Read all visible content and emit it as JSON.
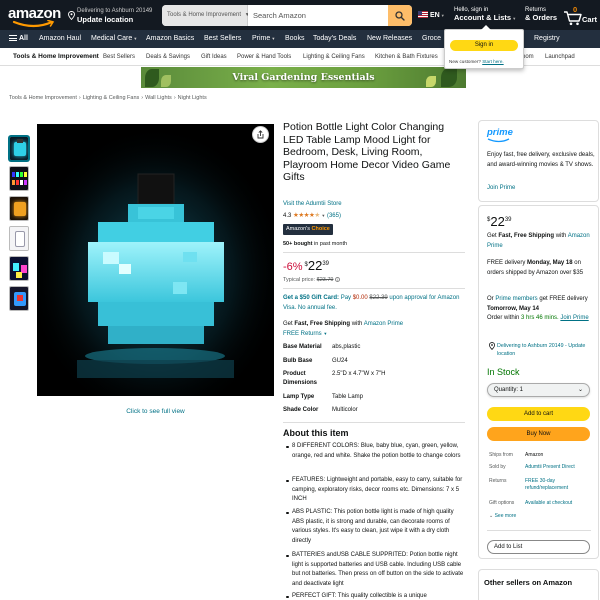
{
  "header": {
    "logo_text": "amazon",
    "deliver_line1": "Delivering to Ashburn 20149",
    "deliver_line2": "Update location",
    "search_category": "Tools & Home Improvement",
    "search_placeholder": "Search Amazon",
    "language": "EN",
    "account_line1": "Hello, sign in",
    "account_line2": "Account & Lists",
    "returns_line1": "Returns",
    "returns_line2": "& Orders",
    "cart_count": "0",
    "cart_label": "Cart"
  },
  "nav_main": {
    "all_label": "All",
    "items": [
      "Amazon Haul",
      "Medical Care",
      "Amazon Basics",
      "Best Sellers",
      "Prime",
      "Books",
      "Today's Deals",
      "New Releases",
      "Groce"
    ],
    "registry": "Registry"
  },
  "signin_popover": {
    "button": "Sign in",
    "new_customer": "New customer?",
    "start_here": "Start here."
  },
  "subnav": {
    "items": [
      "Tools & Home Improvement",
      "Best Sellers",
      "Deals & Savings",
      "Gift Ideas",
      "Power & Hand Tools",
      "Lighting & Ceiling Fans",
      "Kitchen & Bath Fixtures",
      "oom",
      "Launchpad"
    ]
  },
  "banner": {
    "text": "Viral Gardening Essentials"
  },
  "breadcrumb": [
    "Tools & Home Improvement",
    "Lighting & Ceiling Fans",
    "Wall Lights",
    "Night Lights"
  ],
  "gallery": {
    "see_full_view": "Click to see full view"
  },
  "product": {
    "title": "Potion Bottle Light Color Changing LED Table Lamp Mood Light for Bedroom, Desk, Living Room, Playroom Home Decor Video Game Gifts",
    "store_link": "Visit the Adumtii Store",
    "rating": "4.3",
    "rating_count": "(365)",
    "choice_badge_prefix": "Amazon's",
    "choice_badge_suffix": "Choice",
    "bought_bold": "50+ bought",
    "bought_rest": "in past month",
    "discount": "-6%",
    "price_symbol": "$",
    "price_whole": "22",
    "price_fraction": "39",
    "typical_label": "Typical price:",
    "typical_price": "$23.79",
    "card_offer_bold": "Get a $50 Gift Card:",
    "card_offer_pay": "Pay",
    "card_offer_new_price": "$0.00",
    "card_offer_old_price": "$22.39",
    "card_offer_rest": "upon approval for Amazon Visa. No annual fee.",
    "ship_get": "Get",
    "ship_bold": "Fast, Free Shipping",
    "ship_with": "with",
    "ship_prime": "Amazon Prime",
    "free_returns": "FREE Returns",
    "specs": [
      {
        "label": "Base Material",
        "value": "abs,plastic"
      },
      {
        "label": "Bulb Base",
        "value": "GU24"
      },
      {
        "label": "Product Dimensions",
        "value": "2.5\"D x 4.7\"W x 7\"H"
      },
      {
        "label": "Lamp Type",
        "value": "Table Lamp"
      },
      {
        "label": "Shade Color",
        "value": "Multicolor"
      }
    ],
    "about_title": "About this item",
    "bullets": [
      "8 DIFFERENT COLORS: Blue, baby blue, cyan, green, yellow, orange, red and white. Shake the potion bottle to change colors",
      "FEATURES: Lightweight and portable, easy to carry, suitable for camping, exploratory risks, decor rooms etc. Dimensions: 7 x 5 INCH",
      "ABS PLASTIC: This potion bottle light is made of high quality ABS plastic, it is strong and durable, can decorate rooms of various styles. It's easy to clean, just wipe it with a dry cloth directly",
      "BATTERIES andUSB CABLE SUPPRITED: Potion bottle night light is supported batteries and USB cable. Including USB cable but not batteries. Then press on off button on the side to activate and deactivate light",
      "PERFECT GIFT: This quality collectible is a unique"
    ]
  },
  "prime_box": {
    "logo": "prime",
    "text": "Enjoy fast, free delivery, exclusive deals, and award-winning movies & TV shows.",
    "join": "Join Prime"
  },
  "buy_box": {
    "price_symbol": "$",
    "price_whole": "22",
    "price_fraction": "39",
    "ship_get": "Get",
    "ship_bold": "Fast, Free Shipping",
    "ship_with": "with",
    "ship_prime": "Amazon Prime",
    "free_delivery": "FREE delivery",
    "free_delivery_date": "Monday, May 18",
    "free_delivery_rest": "on orders shipped by Amazon over $35",
    "or": "Or",
    "prime_members": "Prime members",
    "get_free": "get FREE delivery",
    "fastest_date": "Tomorrow, May 14",
    "order_within": "Order within",
    "countdown": "3 hrs 46 mins.",
    "join_prime": "Join Prime",
    "deliver_to": "Delivering to Ashburn 20149 - Update location",
    "in_stock": "In Stock",
    "quantity": "Quantity: 1",
    "add_to_cart": "Add to cart",
    "buy_now": "Buy Now",
    "meta": [
      {
        "label": "Ships from",
        "value": "Amazon"
      },
      {
        "label": "Sold by",
        "value": "Adumtii Present Direct"
      },
      {
        "label": "Returns",
        "value": "FREE 30-day refund/replacement"
      },
      {
        "label": "Gift options",
        "value": "Available at checkout"
      }
    ],
    "see_more": "See more",
    "add_to_list": "Add to List"
  },
  "other_sellers": {
    "title": "Other sellers on Amazon"
  },
  "colors": {
    "nav_belt": "#131921",
    "nav_main": "#232f3e",
    "search_button": "#febd69",
    "add_to_cart": "#ffd814",
    "buy_now": "#ffa41c",
    "link": "#007185",
    "deal_red": "#cc0c39",
    "in_stock": "#007600",
    "star": "#de7921"
  }
}
